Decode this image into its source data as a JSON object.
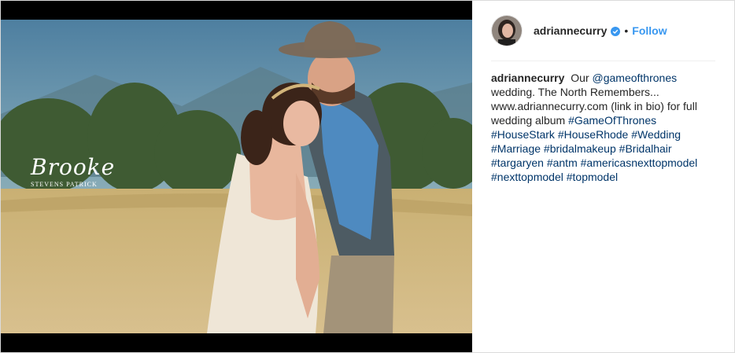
{
  "post": {
    "username": "adriannecurry",
    "dot": "•",
    "follow_label": "Follow",
    "watermark_script": "Brooke",
    "watermark_small": "STEVENS PATRICK"
  },
  "caption": {
    "user": "adriannecurry",
    "t1": "Our",
    "mention": "@gameofthrones",
    "t2": "wedding. The North Remembers... www.adriannecurry.com (link in bio) for full wedding album",
    "h1": "#GameOfThrones",
    "h2": "#HouseStark",
    "h3": "#HouseRhode",
    "h4": "#Wedding",
    "h5": "#Marriage",
    "h6": "#bridalmakeup",
    "h7": "#Bridalhair",
    "h8": "#targaryen",
    "h9": "#antm",
    "h10": "#americasnexttopmodel",
    "h11": "#nexttopmodel",
    "h12": "#topmodel"
  },
  "colors": {
    "follow": "#3897f0",
    "link": "#003569",
    "verified": "#3897f0"
  }
}
